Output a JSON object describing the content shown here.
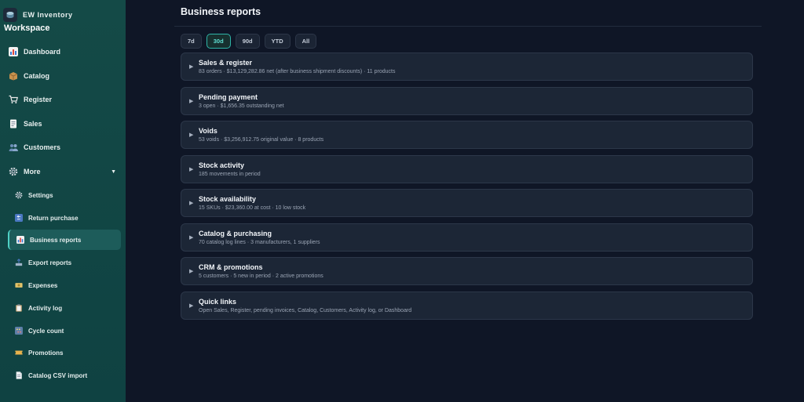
{
  "brand": {
    "name": "EW Inventory",
    "workspace": "Workspace"
  },
  "sidebar": {
    "items": [
      {
        "label": "Dashboard",
        "icon": "bar-chart-icon"
      },
      {
        "label": "Catalog",
        "icon": "box-icon"
      },
      {
        "label": "Register",
        "icon": "cart-icon"
      },
      {
        "label": "Sales",
        "icon": "receipt-icon"
      },
      {
        "label": "Customers",
        "icon": "people-icon"
      },
      {
        "label": "More",
        "icon": "gear-icon"
      }
    ],
    "more_items": [
      {
        "label": "Settings",
        "icon": "gear-icon"
      },
      {
        "label": "Return purchase",
        "icon": "return-icon"
      },
      {
        "label": "Business reports",
        "icon": "bar-chart-icon",
        "active": true
      },
      {
        "label": "Export reports",
        "icon": "export-tray-icon"
      },
      {
        "label": "Expenses",
        "icon": "cash-icon"
      },
      {
        "label": "Activity log",
        "icon": "clipboard-icon"
      },
      {
        "label": "Cycle count",
        "icon": "abacus-icon"
      },
      {
        "label": "Promotions",
        "icon": "ticket-icon"
      },
      {
        "label": "Catalog CSV import",
        "icon": "document-icon"
      }
    ]
  },
  "main": {
    "title": "Business reports",
    "ranges": [
      "7d",
      "30d",
      "90d",
      "YTD",
      "All"
    ],
    "active_range": "30d",
    "sections": [
      {
        "title": "Sales & register",
        "summary": "83 orders · $13,129,282.86 net (after business shipment discounts) · 11 products"
      },
      {
        "title": "Pending payment",
        "summary": "3 open · $1,656.35 outstanding net"
      },
      {
        "title": "Voids",
        "summary": "53 voids · $3,256,912.75 original value · 8 products"
      },
      {
        "title": "Stock activity",
        "summary": "185 movements in period"
      },
      {
        "title": "Stock availability",
        "summary": "15 SKUs · $23,360.00 at cost · 10 low stock"
      },
      {
        "title": "Catalog & purchasing",
        "summary": "70 catalog log lines · 3 manufacturers, 1 suppliers"
      },
      {
        "title": "CRM & promotions",
        "summary": "5 customers · 5 new in period · 2 active promotions"
      },
      {
        "title": "Quick links",
        "summary": "Open Sales, Register, pending invoices, Catalog, Customers, Activity log, or Dashboard"
      }
    ]
  },
  "colors": {
    "accent": "#2fb5a8",
    "sidebar": "#144a47",
    "background": "#0f1626",
    "card": "#1c2636"
  }
}
